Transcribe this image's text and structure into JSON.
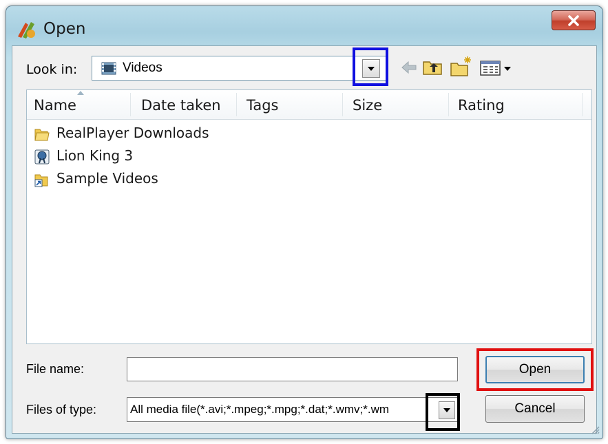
{
  "window": {
    "title": "Open",
    "close_icon": "close-x-icon"
  },
  "look_in": {
    "label": "Look in:",
    "value": "Videos"
  },
  "list": {
    "columns": [
      "Name",
      "Date taken",
      "Tags",
      "Size",
      "Rating"
    ],
    "items": [
      {
        "label": "RealPlayer Downloads",
        "icon": "folder-icon"
      },
      {
        "label": "Lion King 3",
        "icon": "realplayer-file-icon"
      },
      {
        "label": "Sample Videos",
        "icon": "shortcut-folder-icon"
      }
    ]
  },
  "file_name": {
    "label": "File name:",
    "value": ""
  },
  "files_of_type": {
    "label": "Files of type:",
    "value": "All media file(*.avi;*.mpeg;*.mpg;*.dat;*.wmv;*.wm"
  },
  "buttons": {
    "open": "Open",
    "cancel": "Cancel"
  },
  "highlights": {
    "blue": "#1010e0",
    "red": "#e01010",
    "black": "#000000"
  }
}
